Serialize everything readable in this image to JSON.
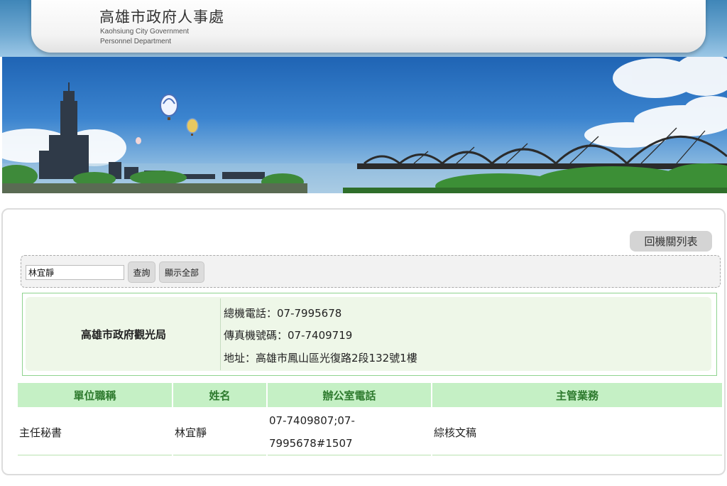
{
  "header": {
    "title": "高雄市政府人事處",
    "subtitle_line1": "Kaohsiung City Government",
    "subtitle_line2": "Personnel Department"
  },
  "toolbar": {
    "back_label": "回機關列表"
  },
  "search": {
    "value": "林宜靜",
    "query_label": "查詢",
    "show_all_label": "顯示全部"
  },
  "organization": {
    "name": "高雄市政府觀光局",
    "main_phone": "總機電話：07-7995678",
    "fax": "傳真機號碼：07-7409719",
    "address": "地址：高雄市鳳山區光復路2段132號1樓"
  },
  "staff_table": {
    "headers": [
      "單位職稱",
      "姓名",
      "辦公室電話",
      "主管業務"
    ],
    "rows": [
      [
        "主任秘書",
        "林宜靜",
        "07-7409807;07-\n7995678#1507",
        "綜核文稿"
      ]
    ]
  },
  "colors": {
    "header_green_bg": "#c5f0c5",
    "header_green_text": "#2d7a2d",
    "org_bg": "#eef7e8",
    "sky_blue": "#2a70be"
  },
  "icons": [
    "hot-air-balloon-icon",
    "bridge-illustration",
    "skyline-illustration"
  ]
}
